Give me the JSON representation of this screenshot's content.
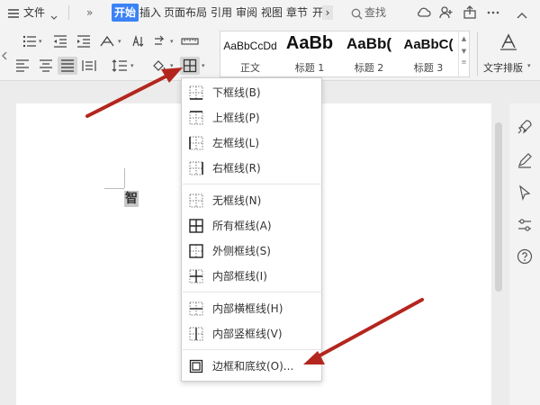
{
  "menubar": {
    "menu_label": "文件",
    "more": "»",
    "tabs": [
      "开始",
      "插入",
      "页面布局",
      "引用",
      "审阅",
      "视图",
      "章节",
      "开"
    ],
    "more_tabs": "›",
    "search_label": "查找"
  },
  "ribbon": {
    "styles": [
      {
        "sample": "AaBbCcDd",
        "name": "正文"
      },
      {
        "sample": "AaBb",
        "name": "标题 1"
      },
      {
        "sample": "AaBb(",
        "name": "标题 2"
      },
      {
        "sample": "AaBbC(",
        "name": "标题 3"
      }
    ],
    "text_layout_label": "文字排版"
  },
  "document": {
    "text": "智"
  },
  "border_menu": {
    "items": [
      {
        "label": "下框线(B)",
        "icon": "bottom-border-icon"
      },
      {
        "label": "上框线(P)",
        "icon": "top-border-icon"
      },
      {
        "label": "左框线(L)",
        "icon": "left-border-icon"
      },
      {
        "label": "右框线(R)",
        "icon": "right-border-icon"
      },
      {
        "label": "无框线(N)",
        "icon": "no-border-icon"
      },
      {
        "label": "所有框线(A)",
        "icon": "all-borders-icon"
      },
      {
        "label": "外侧框线(S)",
        "icon": "outside-borders-icon"
      },
      {
        "label": "内部框线(I)",
        "icon": "inside-borders-icon"
      },
      {
        "label": "内部横框线(H)",
        "icon": "inside-horizontal-border-icon"
      },
      {
        "label": "内部竖框线(V)",
        "icon": "inside-vertical-border-icon"
      },
      {
        "label": "边框和底纹(O)...",
        "icon": "borders-and-shading-icon"
      }
    ]
  },
  "colors": {
    "accent": "#3b82f6",
    "arrow": "#b3261e"
  }
}
